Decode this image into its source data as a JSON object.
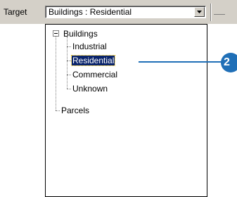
{
  "toolbar": {
    "target_label": "Target",
    "combo_value": "Buildings : Residential",
    "dropdown_icon": "chevron-down-icon"
  },
  "tree": {
    "root": {
      "label": "Buildings",
      "expanded": true,
      "expander_icon": "minus-box-icon"
    },
    "children": [
      {
        "label": "Industrial",
        "selected": false
      },
      {
        "label": "Residential",
        "selected": true
      },
      {
        "label": "Commercial",
        "selected": false
      },
      {
        "label": "Unknown",
        "selected": false
      }
    ],
    "second_root": {
      "label": "Parcels"
    }
  },
  "callout": {
    "number": "2",
    "color": "#1f6fb7"
  },
  "colors": {
    "selection": "#0a246a",
    "chrome": "#d4d0c8"
  }
}
